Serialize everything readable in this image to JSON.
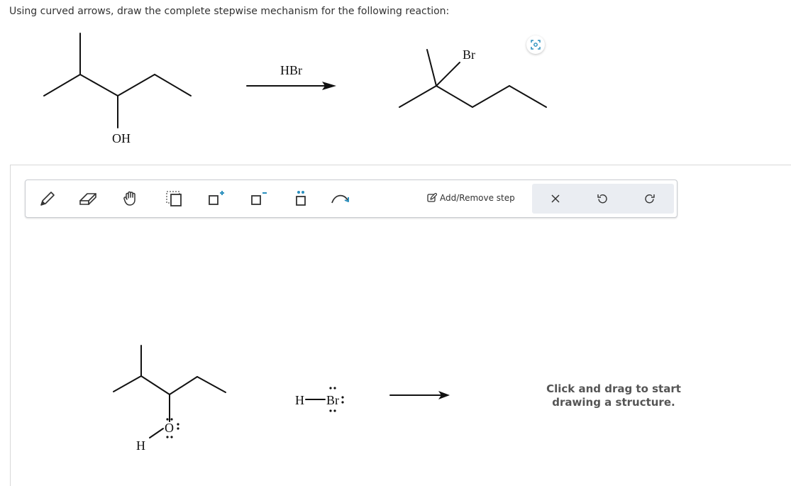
{
  "question": {
    "text": "Using curved arrows, draw the complete stepwise mechanism for the following reaction:"
  },
  "reaction": {
    "reactant_label": "OH",
    "reagent": "HBr",
    "product_label": "Br"
  },
  "toolbar": {
    "tools": [
      {
        "name": "draw-tool",
        "icon": "pencil-icon"
      },
      {
        "name": "erase-tool",
        "icon": "eraser-icon"
      },
      {
        "name": "move-tool",
        "icon": "hand-icon"
      },
      {
        "name": "select-tool",
        "icon": "marquee-select-icon"
      },
      {
        "name": "positive-charge-tool",
        "icon": "positive-charge-icon",
        "symbol": "+"
      },
      {
        "name": "negative-charge-tool",
        "icon": "negative-charge-icon",
        "symbol": "−"
      },
      {
        "name": "lone-pair-tool",
        "icon": "lone-pair-icon"
      },
      {
        "name": "curved-arrow-tool",
        "icon": "curved-arrow-icon"
      }
    ],
    "add_remove_label": "Add/Remove step",
    "actions": [
      {
        "name": "clear-button",
        "icon": "close-icon"
      },
      {
        "name": "undo-button",
        "icon": "undo-icon"
      },
      {
        "name": "redo-button",
        "icon": "redo-icon"
      }
    ]
  },
  "workspace": {
    "h_label": "H",
    "o_label": "O",
    "hbr_h": "H",
    "hbr_br": "Br",
    "hint_line1": "Click and drag to start",
    "hint_line2": "drawing a structure."
  },
  "colors": {
    "accent": "#2a8fbd",
    "action_bg": "#eaedf2",
    "border": "#c9ccd1"
  }
}
